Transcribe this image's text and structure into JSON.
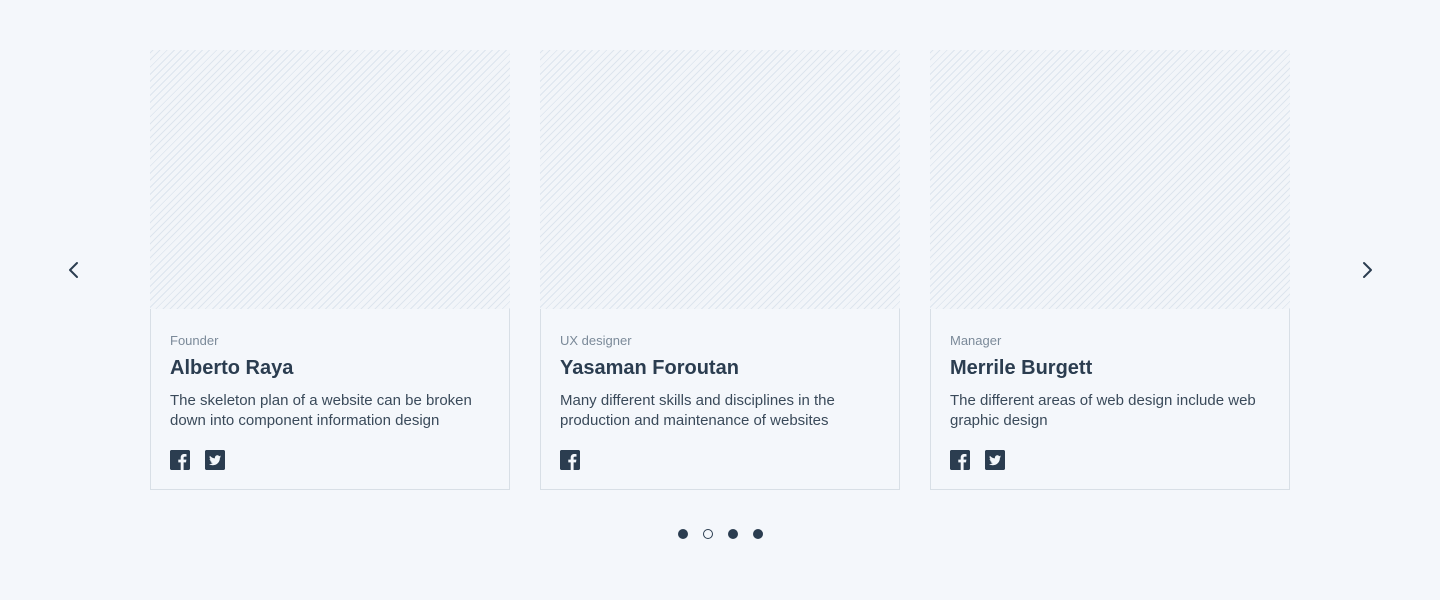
{
  "carousel": {
    "prev_icon": "chevron-left-icon",
    "next_icon": "chevron-right-icon",
    "cards": [
      {
        "role": "Founder",
        "name": "Alberto Raya",
        "description": "The skeleton plan of a website can be broken\ndown into  component information design",
        "socials": [
          "facebook-icon",
          "twitter-icon"
        ]
      },
      {
        "role": "UX designer",
        "name": "Yasaman Foroutan",
        "description": "Many different skills and disciplines in the\nproduction and maintenance of websites",
        "socials": [
          "facebook-icon"
        ]
      },
      {
        "role": "Manager",
        "name": "Merrile Burgett",
        "description": "The different areas of web design include web\ngraphic design",
        "socials": [
          "facebook-icon",
          "twitter-icon"
        ]
      }
    ],
    "pagination": {
      "total": 4,
      "active_index": 1
    }
  },
  "colors": {
    "background": "#f4f7fb",
    "text_dark": "#2b3d50",
    "text_muted": "#7b8a99",
    "border": "#d8dfe6",
    "image_stripe": "#dde5ee"
  }
}
